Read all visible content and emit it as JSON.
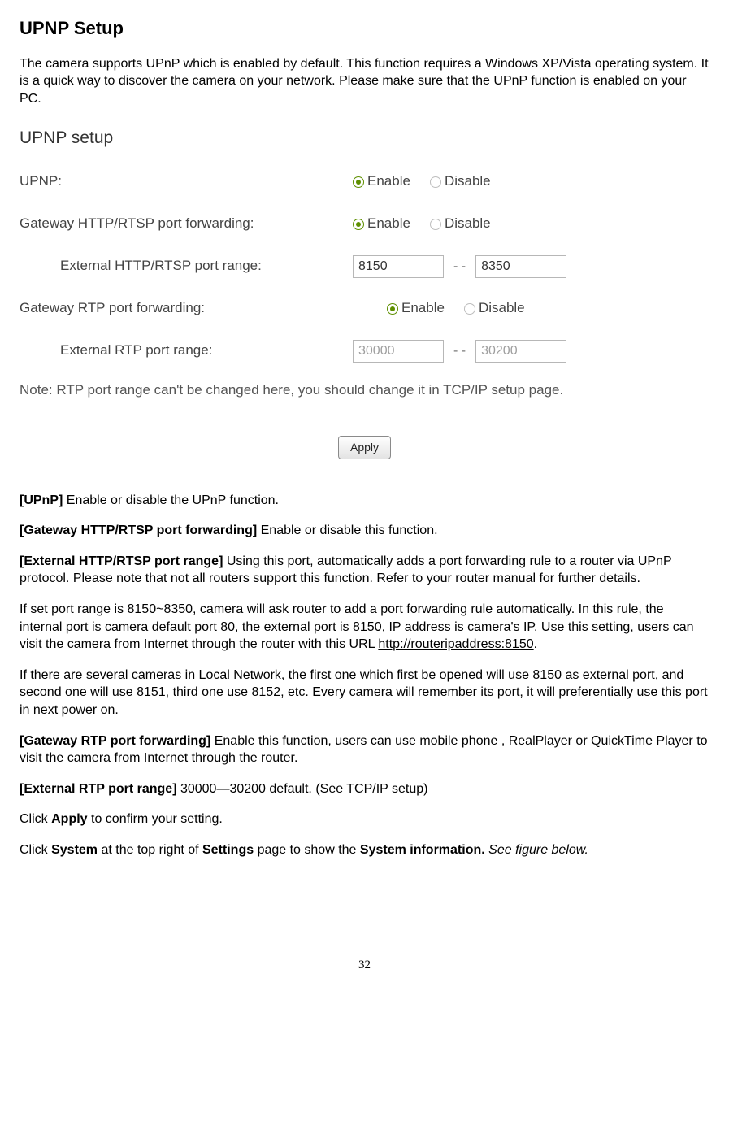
{
  "title": "UPNP Setup",
  "intro": "The camera supports UPnP which is enabled by default. This function requires a Windows XP/Vista operating system. It is a quick way to discover the camera on your network. Please make sure that the UPnP function is enabled on your PC.",
  "form": {
    "panel_title": "UPNP setup",
    "rows": {
      "upnp": {
        "label": "UPNP:",
        "enable": "Enable",
        "disable": "Disable"
      },
      "http_fwd": {
        "label": "Gateway HTTP/RTSP port forwarding:",
        "enable": "Enable",
        "disable": "Disable"
      },
      "http_range": {
        "label": "External HTTP/RTSP port range:",
        "from": "8150",
        "to": "8350"
      },
      "rtp_fwd": {
        "label": "Gateway RTP port forwarding:",
        "enable": "Enable",
        "disable": "Disable"
      },
      "rtp_range": {
        "label": "External RTP port range:",
        "from": "30000",
        "to": "30200"
      }
    },
    "separator": "- -",
    "note": "Note: RTP port range can't be changed here, you should change it in TCP/IP setup page.",
    "apply": "Apply"
  },
  "desc": {
    "p1_bold": "[UPnP]",
    "p1_rest": " Enable or disable the UPnP function.",
    "p2_bold": "[Gateway HTTP/RTSP port forwarding]",
    "p2_rest": " Enable or disable this function.",
    "p3_bold": "[External HTTP/RTSP port range]",
    "p3_rest": " Using this port, automatically adds a port forwarding rule to a router via UPnP protocol. Please note that not all routers support this function. Refer to your router manual for further details.",
    "p4_a": "If set port range is 8150~8350, camera will ask router to add a port forwarding rule automatically. In this rule, the internal port is camera default port 80, the external port is 8150, IP address is camera's IP. Use this setting, users can visit the camera from Internet through the router with this URL ",
    "p4_link": "http://routeripaddress:8150",
    "p4_b": ".",
    "p5": "If there are several cameras in Local Network, the first one which first be opened will use 8150 as external port, and second one will use 8151, third one use 8152, etc. Every camera will remember its port, it will preferentially use this port in next power on.",
    "p6_bold": "[Gateway RTP port forwarding]",
    "p6_rest": " Enable this function, users can use mobile phone , RealPlayer or QuickTime Player to visit the camera from Internet through the router.",
    "p7_bold": "[External RTP port range]",
    "p7_rest": " 30000—30200 default. (See TCP/IP setup)",
    "p8_a": "Click ",
    "p8_bold": "Apply",
    "p8_b": " to confirm your setting.",
    "p9_a": "Click ",
    "p9_b1": "System",
    "p9_b": " at the top right of ",
    "p9_b2": "Settings",
    "p9_c": " page to show the ",
    "p9_b3": "System information.",
    "p9_d": " See figure below."
  },
  "page_number": "32"
}
